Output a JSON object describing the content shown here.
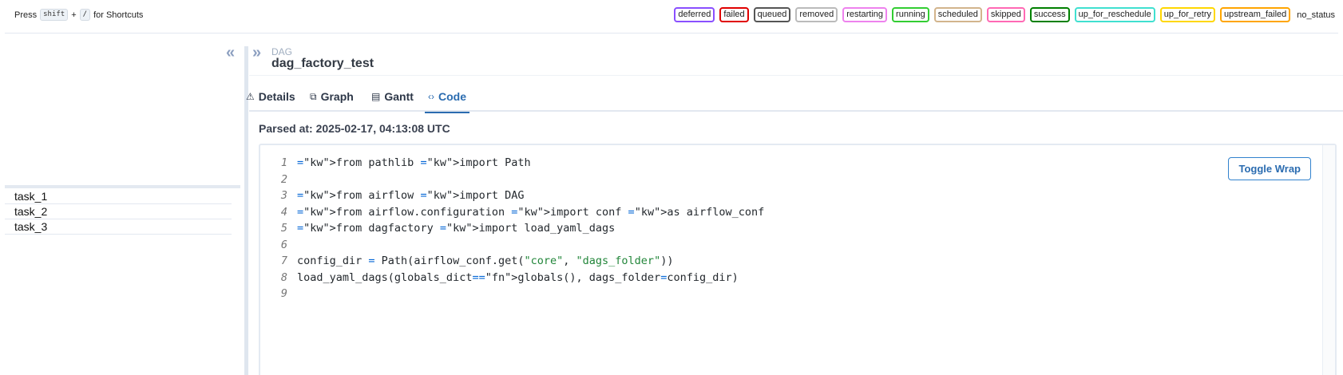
{
  "shortcut_hint": {
    "prefix": "Press",
    "key1": "shift",
    "plus": "+",
    "key2": "/",
    "suffix": "for Shortcuts"
  },
  "legend": [
    {
      "label": "deferred",
      "color": "#8a4fff"
    },
    {
      "label": "failed",
      "color": "#e00000"
    },
    {
      "label": "queued",
      "color": "#555555"
    },
    {
      "label": "removed",
      "color": "#bbbbbb"
    },
    {
      "label": "restarting",
      "color": "#ee82ee"
    },
    {
      "label": "running",
      "color": "#32cd32"
    },
    {
      "label": "scheduled",
      "color": "#d2b48c"
    },
    {
      "label": "skipped",
      "color": "#ff69b4"
    },
    {
      "label": "success",
      "color": "#008000"
    },
    {
      "label": "up_for_reschedule",
      "color": "#40e0d0"
    },
    {
      "label": "up_for_retry",
      "color": "#ffd700"
    },
    {
      "label": "upstream_failed",
      "color": "#ffa500"
    }
  ],
  "legend_plain": "no_status",
  "left_panel": {
    "collapse_icon": "«",
    "tasks": [
      "task_1",
      "task_2",
      "task_3"
    ]
  },
  "header": {
    "expand_icon": "»",
    "kicker": "DAG",
    "dag_id": "dag_factory_test"
  },
  "tabs": [
    {
      "label": "Details",
      "icon": "⚠",
      "active": false
    },
    {
      "label": "Graph",
      "icon": "⧉",
      "active": false
    },
    {
      "label": "Gantt",
      "icon": "▤",
      "active": false
    },
    {
      "label": "Code",
      "icon": "‹›",
      "active": true
    }
  ],
  "parsed_at": "Parsed at: 2025-02-17, 04:13:08 UTC",
  "toggle_wrap_label": "Toggle Wrap",
  "code_lines": [
    "from pathlib import Path",
    "",
    "from airflow import DAG",
    "from airflow.configuration import conf as airflow_conf",
    "from dagfactory import load_yaml_dags",
    "",
    "config_dir = Path(airflow_conf.get(\"core\", \"dags_folder\"))",
    "load_yaml_dags(globals_dict=globals(), dags_folder=config_dir)",
    ""
  ],
  "colors": {
    "accent": "#2b6cb0",
    "keyword": "#a626a4",
    "string": "#22863a"
  }
}
